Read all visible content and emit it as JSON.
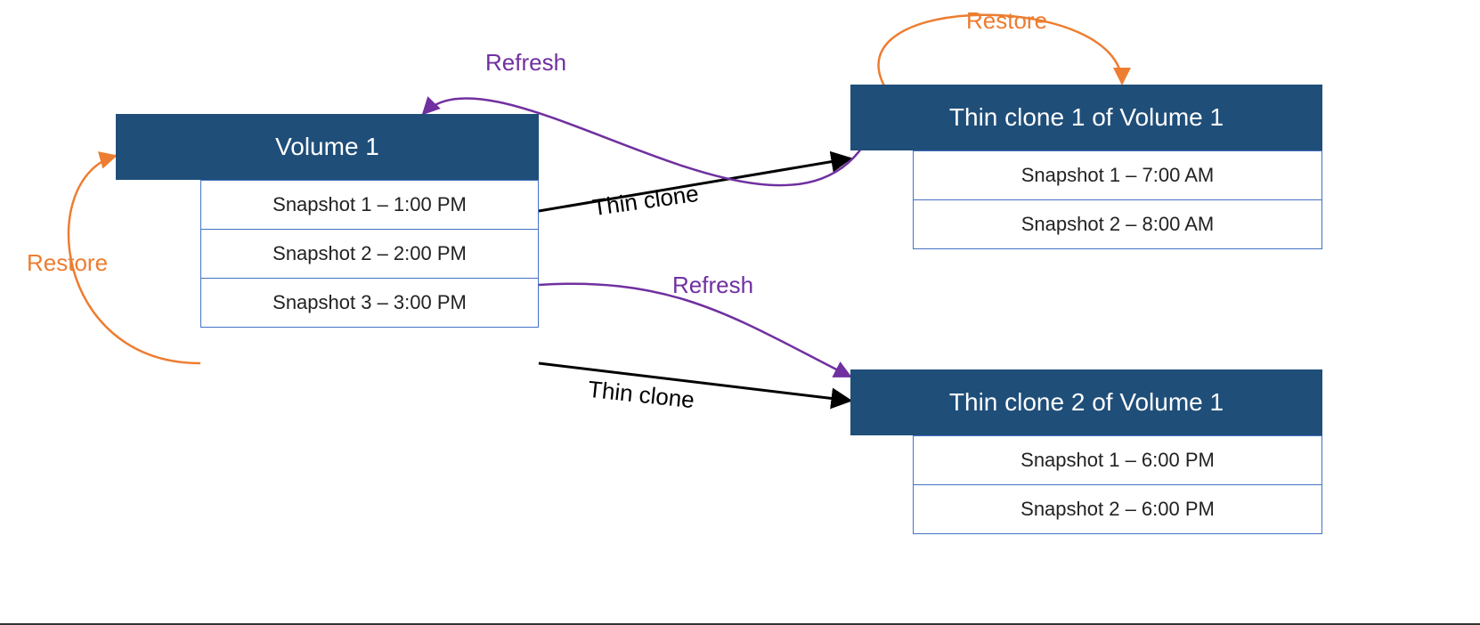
{
  "volumes": {
    "v1": {
      "title": "Volume 1",
      "snaps": [
        "Snapshot 1 – 1:00 PM",
        "Snapshot 2 – 2:00 PM",
        "Snapshot 3 – 3:00 PM"
      ]
    },
    "c1": {
      "title": "Thin clone 1 of Volume 1",
      "snaps": [
        "Snapshot 1 – 7:00 AM",
        "Snapshot 2 – 8:00 AM"
      ]
    },
    "c2": {
      "title": "Thin clone 2 of Volume 1",
      "snaps": [
        "Snapshot 1 – 6:00 PM",
        "Snapshot 2 – 6:00 PM"
      ]
    }
  },
  "labels": {
    "restore_left": "Restore",
    "restore_right": "Restore",
    "refresh_top": "Refresh",
    "refresh_mid": "Refresh",
    "thin_clone_top": "Thin clone",
    "thin_clone_bottom": "Thin clone"
  },
  "colors": {
    "header_bg": "#1f4e79",
    "snap_border": "#4472c4",
    "restore": "#ed7d31",
    "refresh": "#7030a0",
    "thinclone": "#000000"
  }
}
